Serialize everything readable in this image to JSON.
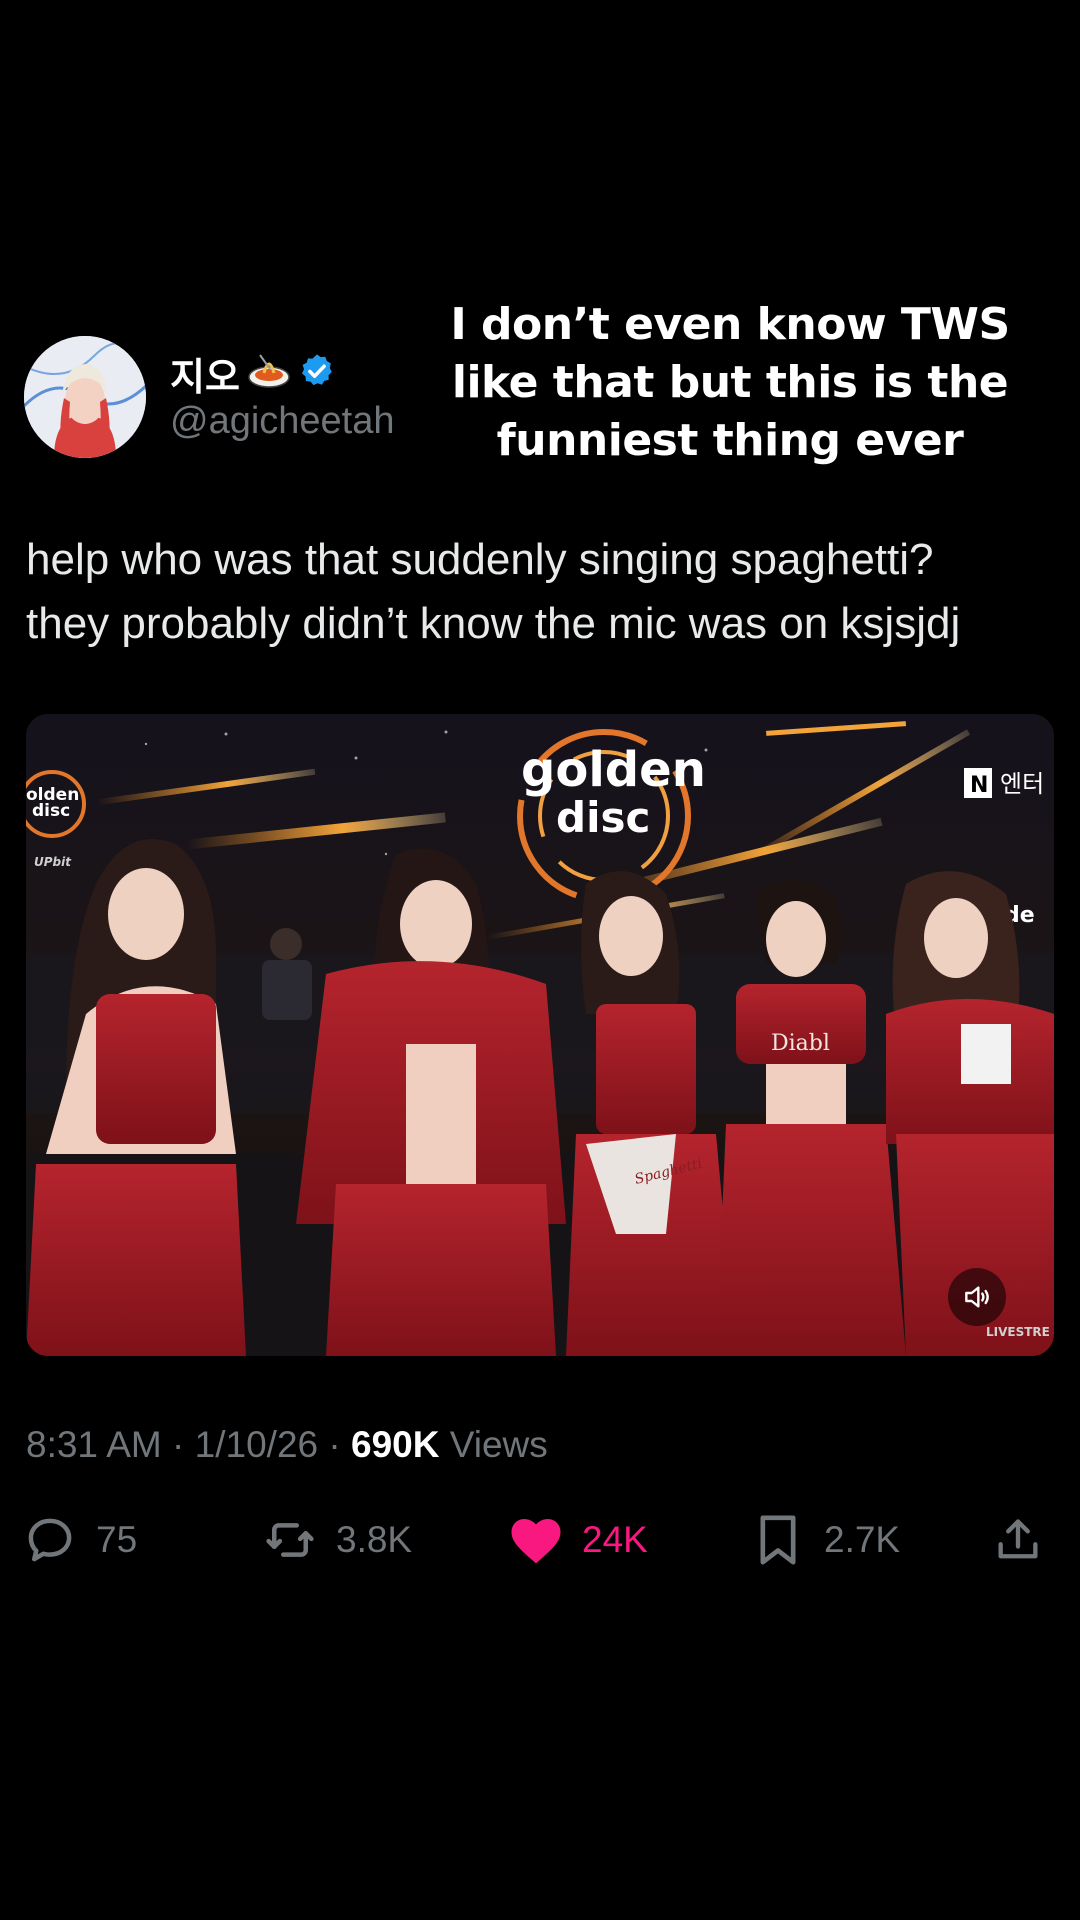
{
  "overlay": {
    "caption_lines": [
      "I don’t even know TWS",
      "like that but this is the",
      "funniest thing ever"
    ]
  },
  "tweet": {
    "display_name": "지오",
    "handle": "@agicheetah",
    "verified": true,
    "text_lines": [
      "help who was that suddenly singing spaghetti?",
      "they probably didn’t know the mic was on ksjsjdj"
    ],
    "media": {
      "stage_logo_line1": "golden",
      "stage_logo_line2": "disc",
      "corner_logo_line1": "olden",
      "corner_logo_line2": "disc",
      "corner_sponsor": "UPbit",
      "channel_badge": "N",
      "channel_text": "엔터",
      "side_text": "de",
      "shirt_text": "Diabl",
      "skirt_text": "Spaghetti",
      "watermark": "LIVESTRE",
      "sound_icon": "speaker-icon"
    },
    "time": "8:31 AM",
    "date": "1/10/26",
    "views_count": "690K",
    "views_label": "Views",
    "separator": "·",
    "stats": {
      "replies": "75",
      "reposts": "3.8K",
      "likes": "24K",
      "bookmarks": "2.7K"
    },
    "colors": {
      "like": "#f91880",
      "verified": "#1d9bf0",
      "muted": "#71767b"
    }
  }
}
